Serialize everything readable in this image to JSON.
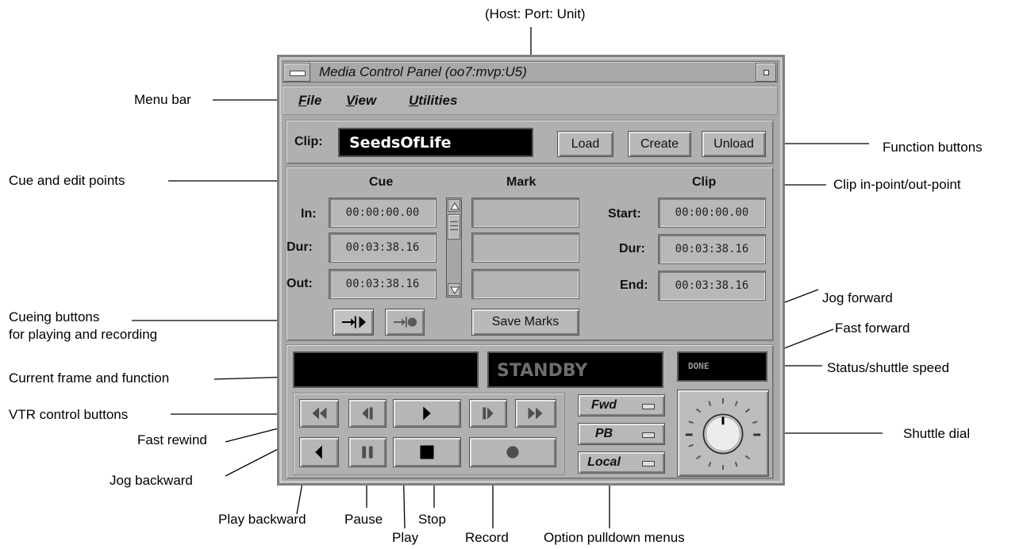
{
  "callouts": {
    "host_port_unit": "(Host: Port: Unit)",
    "menu_bar": "Menu bar",
    "function_buttons": "Function buttons",
    "cue_edit_points": "Cue and edit points",
    "clip_in_out": "Clip in-point/out-point",
    "cueing_buttons_1": "Cueing buttons",
    "cueing_buttons_2": "for playing and recording",
    "jog_forward": "Jog forward",
    "fast_forward": "Fast forward",
    "current_frame": "Current frame and function",
    "status_shuttle": "Status/shuttle speed",
    "vtr_buttons": "VTR control buttons",
    "fast_rewind": "Fast rewind",
    "shuttle_dial": "Shuttle dial",
    "jog_backward": "Jog backward",
    "play_backward": "Play backward",
    "pause": "Pause",
    "stop": "Stop",
    "play": "Play",
    "record": "Record",
    "option_menus": "Option pulldown menus"
  },
  "window": {
    "title": "Media Control Panel (oo7:mvp:U5)"
  },
  "menus": [
    "File",
    "View",
    "Utilities"
  ],
  "clip": {
    "label": "Clip:",
    "name": "SeedsOfLife",
    "load": "Load",
    "create": "Create",
    "unload": "Unload"
  },
  "points": {
    "cue_header": "Cue",
    "mark_header": "Mark",
    "clip_header": "Clip",
    "in_label": "In:",
    "dur_label": "Dur:",
    "out_label": "Out:",
    "in_value": "00:00:00.00",
    "dur_value": "00:03:38.16",
    "out_value": "00:03:38.16",
    "start_label": "Start:",
    "clip_dur_label": "Dur:",
    "end_label": "End:",
    "start_value": "00:00:00.00",
    "clip_dur_value": "00:03:38.16",
    "end_value": "00:03:38.16",
    "save_marks": "Save Marks"
  },
  "status": {
    "current_frame": "",
    "function": "STANDBY",
    "shuttle": "DONE"
  },
  "options": {
    "fwd": "Fwd",
    "pb": "PB",
    "local": "Local"
  },
  "colors": {
    "panel": "#b0b0b0",
    "display_bg": "#000000",
    "clip_text": "#ffffff",
    "standby_text": "#6e6e6e"
  }
}
